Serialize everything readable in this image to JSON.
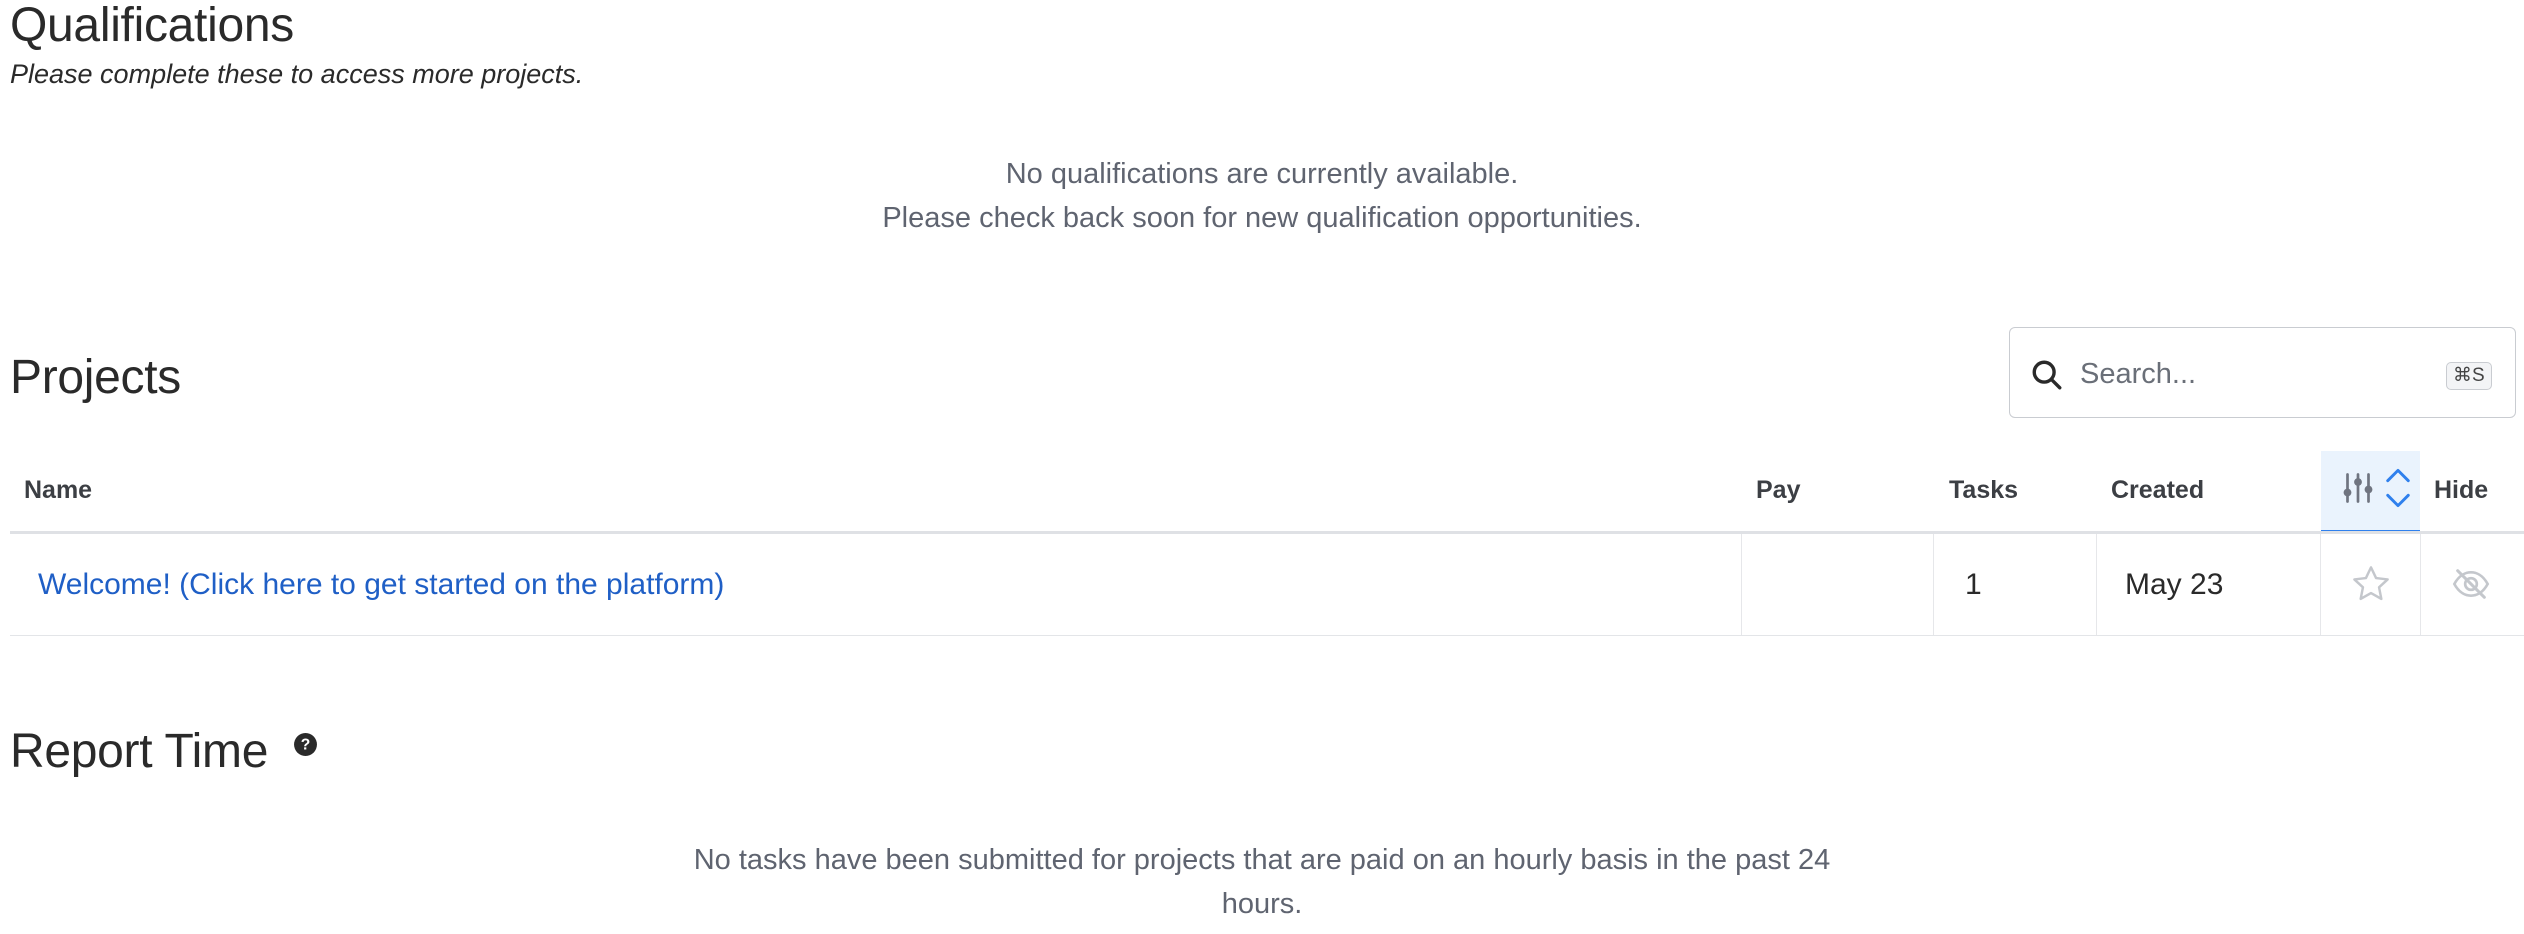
{
  "qualifications": {
    "title": "Qualifications",
    "subtitle": "Please complete these to access more projects.",
    "empty_line1": "No qualifications are currently available.",
    "empty_line2": "Please check back soon for new qualification opportunities."
  },
  "projects": {
    "title": "Projects",
    "search": {
      "placeholder": "Search...",
      "shortcut": "⌘S",
      "icon": "search-icon"
    },
    "columns": {
      "name": "Name",
      "pay": "Pay",
      "tasks": "Tasks",
      "created": "Created",
      "hide": "Hide"
    },
    "rows": [
      {
        "name": "Welcome! (Click here to get started on the platform)",
        "pay": "",
        "tasks": "1",
        "created": "May 23"
      }
    ],
    "colors": {
      "link": "#1f5fc6",
      "active_header": "#2f80ed",
      "active_header_bg": "#eaf3fd"
    }
  },
  "report_time": {
    "title": "Report Time",
    "help_icon": "question-circle-icon",
    "empty_line1": "No tasks have been submitted for projects that are paid on an hourly basis in the past 24",
    "empty_line2": "hours."
  }
}
